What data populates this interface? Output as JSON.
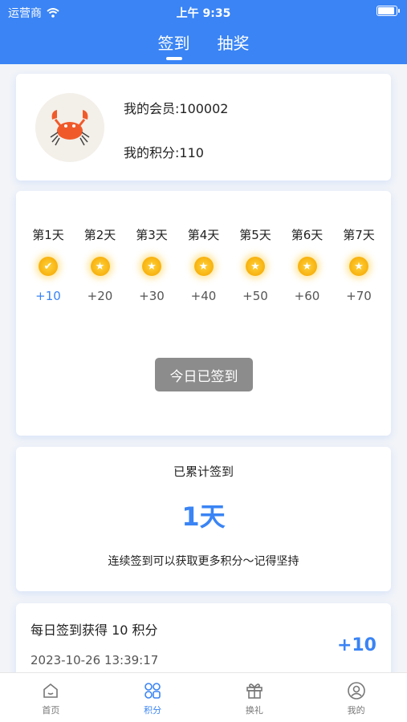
{
  "status_bar": {
    "carrier": "运营商",
    "time": "上午 9:35",
    "battery_level": 1.0
  },
  "header": {
    "tabs": [
      {
        "label": "签到",
        "active": true
      },
      {
        "label": "抽奖",
        "active": false
      }
    ]
  },
  "member": {
    "membership_label": "我的会员:100002",
    "points_label": "我的积分:110",
    "avatar_icon": "crab-icon"
  },
  "checkin": {
    "days": [
      {
        "label": "第1天",
        "points": "+10",
        "checked": true
      },
      {
        "label": "第2天",
        "points": "+20",
        "checked": false
      },
      {
        "label": "第3天",
        "points": "+30",
        "checked": false
      },
      {
        "label": "第4天",
        "points": "+40",
        "checked": false
      },
      {
        "label": "第5天",
        "points": "+50",
        "checked": false
      },
      {
        "label": "第6天",
        "points": "+60",
        "checked": false
      },
      {
        "label": "第7天",
        "points": "+70",
        "checked": false
      }
    ],
    "button_label": "今日已签到"
  },
  "total": {
    "title": "已累计签到",
    "value": "1天",
    "tip": "连续签到可以获取更多积分～记得坚持"
  },
  "record": {
    "title": "每日签到获得 10 积分",
    "time": "2023-10-26 13:39:17",
    "points": "+10"
  },
  "tabbar": [
    {
      "label": "首页",
      "icon": "home-icon",
      "active": false
    },
    {
      "label": "积分",
      "icon": "grid-icon",
      "active": true
    },
    {
      "label": "换礼",
      "icon": "gift-icon",
      "active": false
    },
    {
      "label": "我的",
      "icon": "profile-icon",
      "active": false
    }
  ],
  "colors": {
    "accent": "#3a84f5",
    "coin": "#f7b10e",
    "button_disabled": "#8c8c8c",
    "background": "#f2f4f8"
  }
}
